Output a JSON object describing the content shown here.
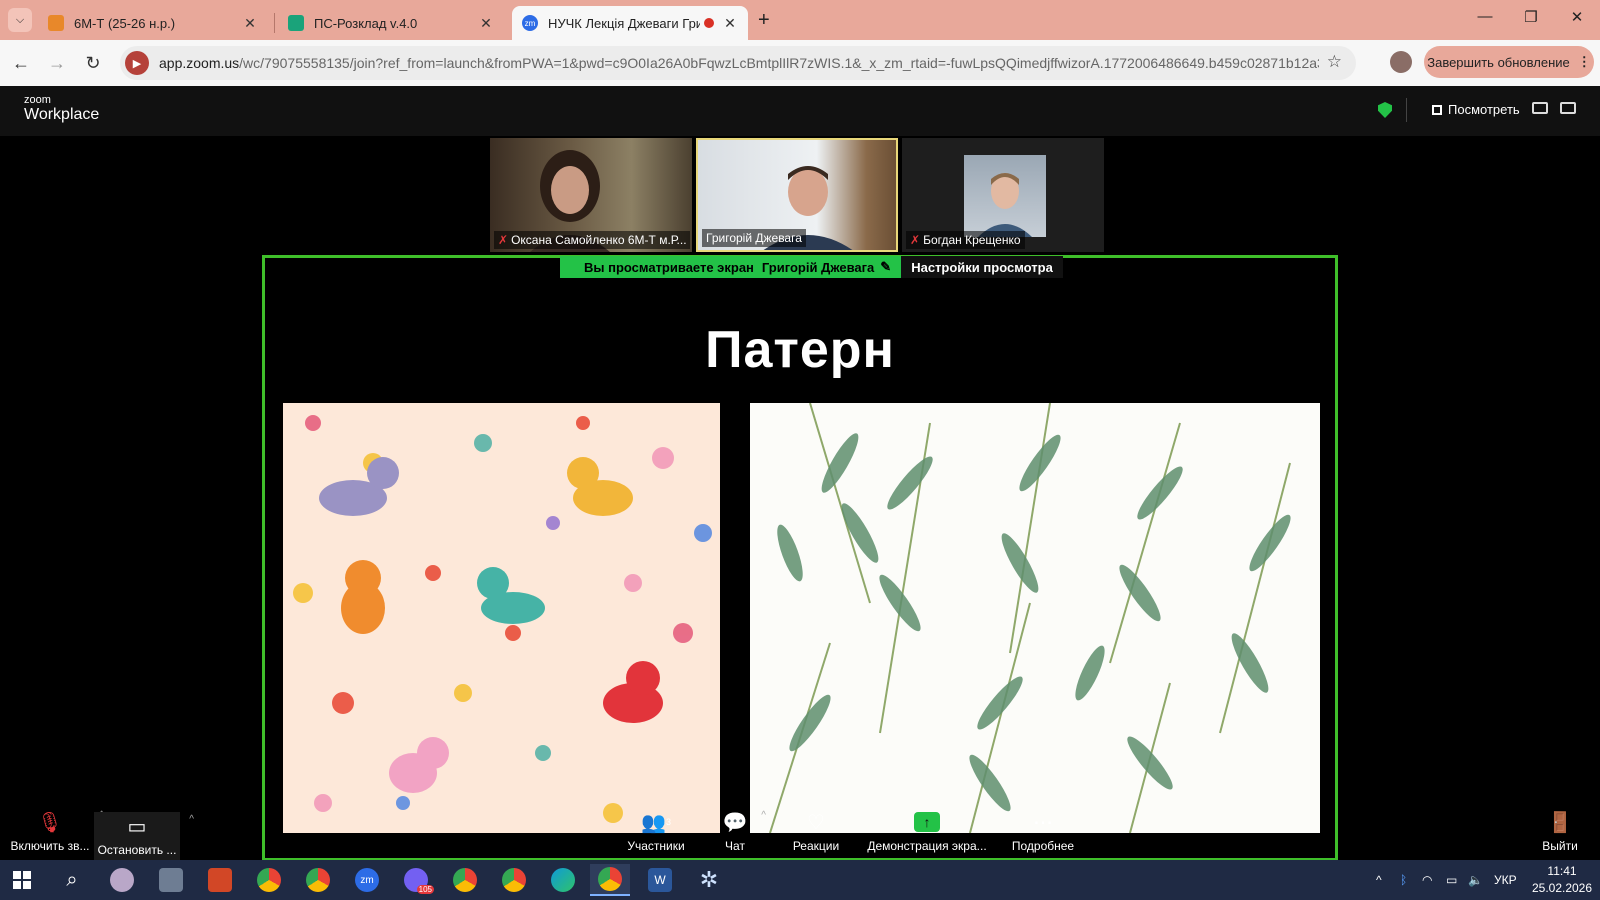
{
  "browser": {
    "tabs": [
      {
        "label": "6М-Т (25-26 н.р.)",
        "favicon_color": "#e8882a"
      },
      {
        "label": "ПС-Розклад v.4.0",
        "favicon_color": "#1aa37a"
      },
      {
        "label": "НУЧК Лекція Джеваги Гри",
        "favicon_color": "#2d6ce6",
        "favicon_text": "zm"
      }
    ],
    "url_host": "app.zoom.us",
    "url_rest": "/wc/79075558135/join?ref_from=launch&fromPWA=1&pwd=c9O0Ia26A0bFqwzLcBmtplIlR7zWIS.1&_x_zm_rtaid=-fuwLpsQQimedjffwizorA.1772006486649.b459c02871b12a34...",
    "update_button": "Завершить обновление"
  },
  "zoom": {
    "logo_small": "zoom",
    "logo_big": "Workplace",
    "view_button": "Посмотреть",
    "participants": [
      {
        "name": "Оксана Самойленко 6М-Т м.Р...",
        "muted": true
      },
      {
        "name": "Григорій Джевага",
        "muted": false
      },
      {
        "name": "Богдан Крещенко",
        "muted": true
      }
    ],
    "share_banner": {
      "viewing": "Вы просматриваете экран",
      "presenter": "Григорій Джевага",
      "settings": "Настройки просмотра"
    },
    "slide": {
      "title": "Патерн"
    },
    "toolbar": {
      "audio": "Включить зв...",
      "video": "Остановить ...",
      "participants": "Участники",
      "participants_count": "3",
      "chat": "Чат",
      "reactions": "Реакции",
      "share": "Демонстрация экра...",
      "more": "Подробнее",
      "leave": "Выйти"
    }
  },
  "taskbar": {
    "lang": "УКР",
    "time": "11:41",
    "date": "25.02.2026",
    "viber_badge": "105"
  }
}
